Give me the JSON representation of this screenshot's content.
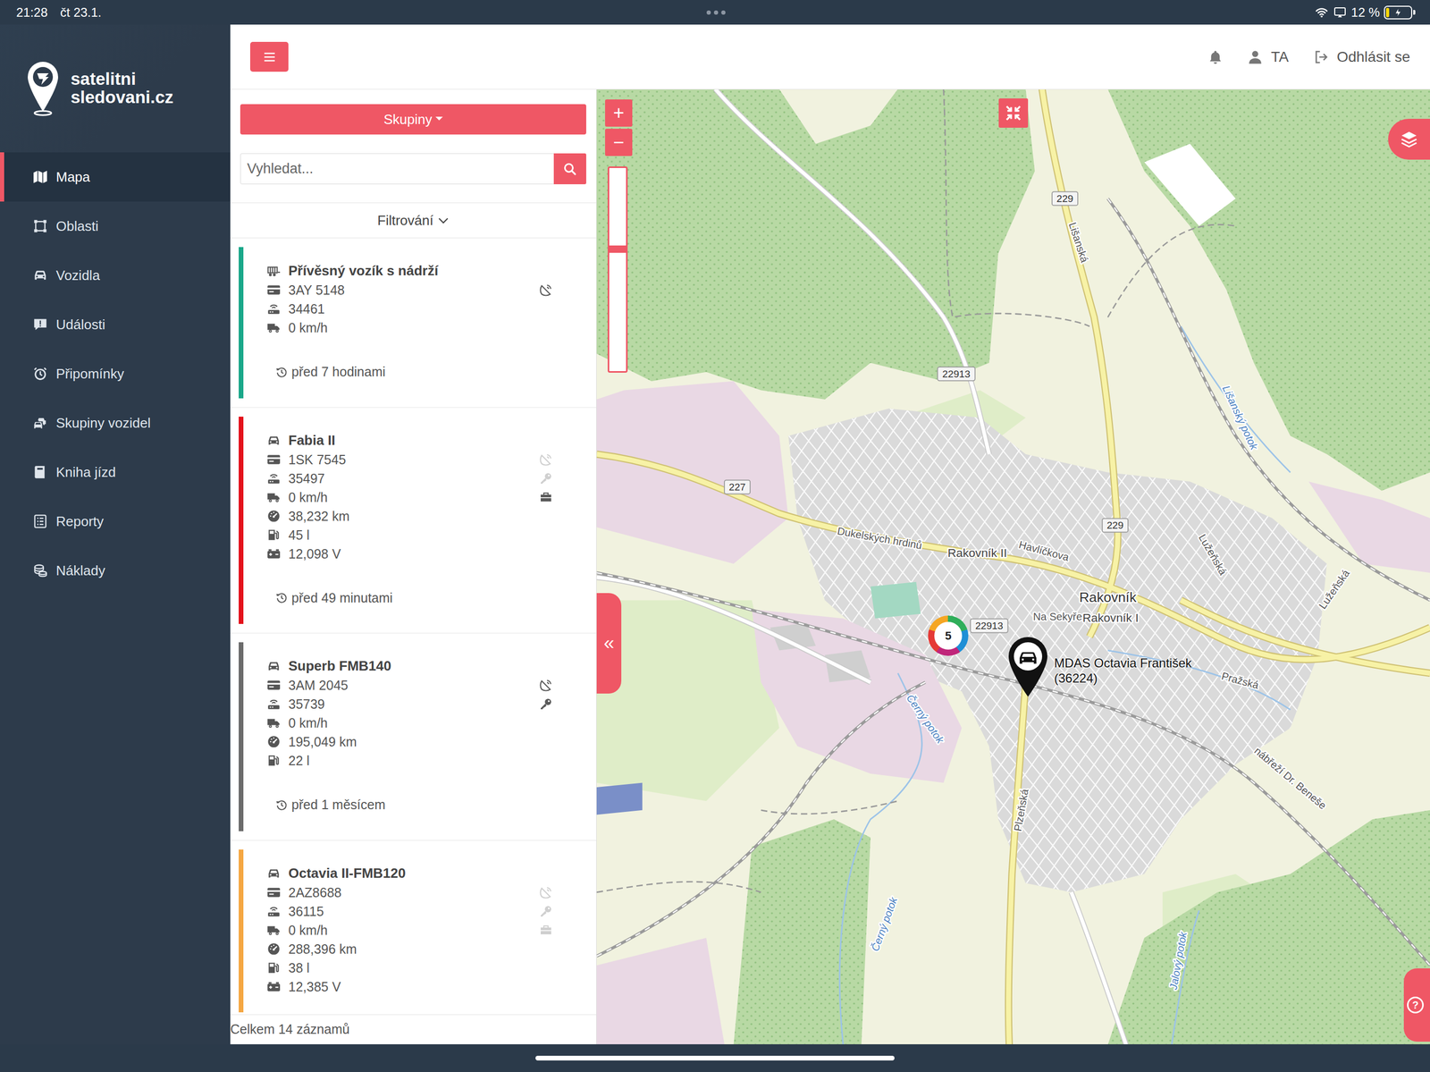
{
  "status_bar": {
    "time": "21:28",
    "date": "čt 23.1.",
    "battery": {
      "text": "12 %",
      "level": 0.12,
      "charging": true
    }
  },
  "logo": {
    "line1": "satelitni",
    "line2": "sledovani.cz"
  },
  "sidebar": {
    "items": [
      {
        "label": "Mapa",
        "selected": true
      },
      {
        "label": "Oblasti",
        "selected": false
      },
      {
        "label": "Vozidla",
        "selected": false
      },
      {
        "label": "Události",
        "selected": false
      },
      {
        "label": "Připomínky",
        "selected": false
      },
      {
        "label": "Skupiny vozidel",
        "selected": false
      },
      {
        "label": "Kniha jízd",
        "selected": false
      },
      {
        "label": "Reporty",
        "selected": false
      },
      {
        "label": "Náklady",
        "selected": false
      }
    ]
  },
  "top_bar": {
    "user": "TA",
    "logout": "Odhlásit se"
  },
  "list_panel": {
    "groups_button": "Skupiny",
    "search": {
      "placeholder": "Vyhledat..."
    },
    "filter": "Filtrování",
    "footer": "Celkem 14 záznamů"
  },
  "vehicles": [
    {
      "kind": "trailer",
      "title": "Přívěsný vozík s nádrží",
      "color": "#1aa88a",
      "rows": [
        {
          "kind": "plate",
          "text": "3AY 5148"
        },
        {
          "kind": "unit",
          "text": "34461"
        },
        {
          "kind": "speed",
          "text": "0 km/h"
        }
      ],
      "indicators": [
        {
          "kind": "gps",
          "active": true
        }
      ],
      "time": "před 7 hodinami"
    },
    {
      "kind": "car",
      "title": "Fabia II",
      "color": "#e4121b",
      "rows": [
        {
          "kind": "plate",
          "text": "1SK 7545"
        },
        {
          "kind": "unit",
          "text": "35497"
        },
        {
          "kind": "speed",
          "text": "0 km/h"
        },
        {
          "kind": "odometer",
          "text": "38,232 km"
        },
        {
          "kind": "fuel",
          "text": "45 l"
        },
        {
          "kind": "voltage",
          "text": "12,098 V"
        }
      ],
      "indicators": [
        {
          "kind": "gps",
          "active": false
        },
        {
          "kind": "key",
          "active": false
        },
        {
          "kind": "briefcase",
          "active": true
        }
      ],
      "time": "před 49 minutami"
    },
    {
      "kind": "car",
      "title": "Superb FMB140",
      "color": "#6b6b6b",
      "rows": [
        {
          "kind": "plate",
          "text": "3AM 2045"
        },
        {
          "kind": "unit",
          "text": "35739"
        },
        {
          "kind": "speed",
          "text": "0 km/h"
        },
        {
          "kind": "odometer",
          "text": "195,049 km"
        },
        {
          "kind": "fuel",
          "text": "22 l"
        }
      ],
      "indicators": [
        {
          "kind": "gps",
          "active": true
        },
        {
          "kind": "key",
          "active": true
        }
      ],
      "time": "před 1 měsícem"
    },
    {
      "kind": "car",
      "title": "Octavia II-FMB120",
      "color": "#f5a742",
      "rows": [
        {
          "kind": "plate",
          "text": "2AZ8688"
        },
        {
          "kind": "unit",
          "text": "36115"
        },
        {
          "kind": "speed",
          "text": "0 km/h"
        },
        {
          "kind": "odometer",
          "text": "288,396 km"
        },
        {
          "kind": "fuel",
          "text": "38 l"
        },
        {
          "kind": "voltage",
          "text": "12,385 V"
        }
      ],
      "indicators": [
        {
          "kind": "gps",
          "active": false
        },
        {
          "kind": "key",
          "active": false
        },
        {
          "kind": "briefcase",
          "active": false
        }
      ]
    }
  ],
  "map": {
    "zoom": {
      "in": "+",
      "out": "−",
      "level": 0.6
    },
    "collapse": "«",
    "help": "?",
    "cluster": {
      "count": "5"
    },
    "marker": {
      "name": "MDAS Octavia František",
      "id": "(36224)"
    },
    "labels": [
      {
        "text": "229",
        "kind": "road_number"
      },
      {
        "text": "Lišanská",
        "kind": "street"
      },
      {
        "text": "22913",
        "kind": "road_number"
      },
      {
        "text": "227",
        "kind": "road_number"
      },
      {
        "text": "Dukelských hrdinů",
        "kind": "street"
      },
      {
        "text": "Rakovník II",
        "kind": "place"
      },
      {
        "text": "Havlíčkova",
        "kind": "street"
      },
      {
        "text": "229",
        "kind": "road_number"
      },
      {
        "text": "Lužeňská",
        "kind": "street"
      },
      {
        "text": "Rakovník",
        "kind": "place_big"
      },
      {
        "text": "Rakovník I",
        "kind": "place"
      },
      {
        "text": "Pražská",
        "kind": "street"
      },
      {
        "text": "Lužeňská",
        "kind": "street"
      },
      {
        "text": "Lišanský potok",
        "kind": "water"
      },
      {
        "text": "Černý potok",
        "kind": "water"
      },
      {
        "text": "Černý potok",
        "kind": "water"
      },
      {
        "text": "Plzeňská",
        "kind": "street"
      },
      {
        "text": "Jalový potok",
        "kind": "water"
      },
      {
        "text": "nábřeží Dr. Beneše",
        "kind": "street"
      },
      {
        "text": "Na Sekyře",
        "kind": "street"
      },
      {
        "text": "22913",
        "kind": "road_number"
      }
    ]
  }
}
